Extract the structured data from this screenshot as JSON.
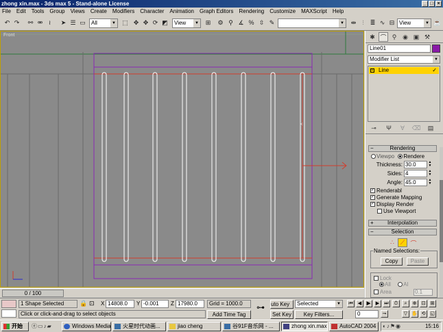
{
  "window": {
    "title": "zhong xin.max - 3ds max 5 - Stand-alone License"
  },
  "menu": [
    "File",
    "Edit",
    "Tools",
    "Group",
    "Views",
    "Create",
    "Modifiers",
    "Character",
    "Animation",
    "Graph Editors",
    "Rendering",
    "Customize",
    "MAXScript",
    "Help"
  ],
  "toolbar": {
    "selection_filter": "All",
    "ref_coord": "View",
    "named_sel": "",
    "view_dd": "View"
  },
  "viewport": {
    "label": "Front"
  },
  "timeline": {
    "frame": "0 / 100"
  },
  "panel": {
    "object_name": "Line01",
    "object_color": "#8a1aa8",
    "modifier_list": "Modifier List",
    "stack_item": "Line",
    "rendering": {
      "title": "Rendering",
      "viewport_label": "Viewpo",
      "renderer_label": "Rendere",
      "thickness_label": "Thickness:",
      "thickness": "30.0",
      "sides_label": "Sides:",
      "sides": "4",
      "angle_label": "Angle:",
      "angle": "45.0",
      "renderable": "Renderabl",
      "gen_mapping": "Generate Mapping",
      "display_render": "Display Render",
      "use_viewport": "Use Viewport"
    },
    "interpolation": {
      "title": "Interpolation"
    },
    "selection": {
      "title": "Selection",
      "named_sel": "Named Selections:",
      "copy": "Copy",
      "paste": "Paste",
      "lock": "Lock",
      "all": "All",
      "al": "Al",
      "area": "Area",
      "area_val": "0.1"
    }
  },
  "status": {
    "selected": "1 Shape Selected",
    "x_label": "X",
    "x": "14808.0",
    "y_label": "Y",
    "y": "-0.001",
    "z_label": "Z",
    "z": "17980.0",
    "grid": "Grid = 1000.0",
    "prompt": "Click or click-and-drag to select objects",
    "add_time_tag": "Add Time Tag",
    "auto_key": "uto Key",
    "set_key": "Set Key",
    "key_mode": "Selected",
    "key_filters": "Key Filters...",
    "frame_field": "0"
  },
  "taskbar": {
    "start": "开始",
    "tasks": [
      "Windows Media ...",
      "火星时代动画...",
      "jiao cheng",
      "谷91F音乐网 - ...",
      "zhong xin.max - ...",
      "AutoCAD 2004 - ..."
    ],
    "clock": "15:16"
  },
  "colors": {
    "title": "#0a246a",
    "viewport_bg": "#8a8a8a",
    "accent_yellow": "#ffd200",
    "spline_red": "#d23c2c",
    "spline_purple": "#8a28b4"
  }
}
